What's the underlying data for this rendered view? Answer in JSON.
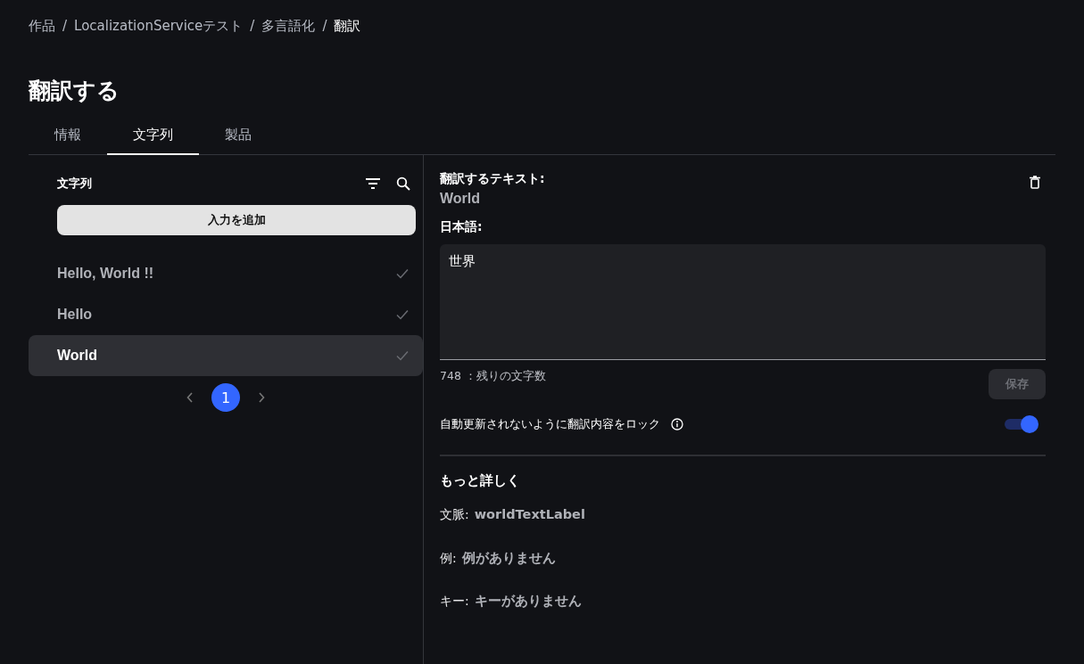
{
  "breadcrumb_separator": "/",
  "breadcrumb": [
    {
      "label": "作品",
      "current": false
    },
    {
      "label": "LocalizationServiceテスト",
      "current": false
    },
    {
      "label": "多言語化",
      "current": false
    },
    {
      "label": "翻訳",
      "current": true
    }
  ],
  "title": "翻訳する",
  "tabs": [
    {
      "label": "情報",
      "selected": false
    },
    {
      "label": "文字列",
      "selected": true
    },
    {
      "label": "製品",
      "selected": false
    }
  ],
  "strings_panel": {
    "title": "文字列",
    "add_button": "入力を追加",
    "items": [
      {
        "label": "Hello, World !!",
        "done": true,
        "selected": false
      },
      {
        "label": "Hello",
        "done": true,
        "selected": false
      },
      {
        "label": "World",
        "done": true,
        "selected": true
      }
    ],
    "pages": [
      {
        "label": "1",
        "selected": true
      }
    ]
  },
  "editor": {
    "source_label": "翻訳するテキスト:",
    "source_text": "World",
    "target_label": "日本語:",
    "value": "世界",
    "remaining": "748 ：残りの文字数",
    "save_button": {
      "label": "保存",
      "disabled": true
    },
    "lock": {
      "label": "自動更新されないように翻訳内容をロック",
      "on": true
    },
    "more_title": "もっと詳しく",
    "details": [
      {
        "label": "文脈:",
        "value": "worldTextLabel"
      },
      {
        "label": "例:",
        "value": "例がありません"
      },
      {
        "label": "キー:",
        "value": "キーがありません"
      }
    ]
  }
}
